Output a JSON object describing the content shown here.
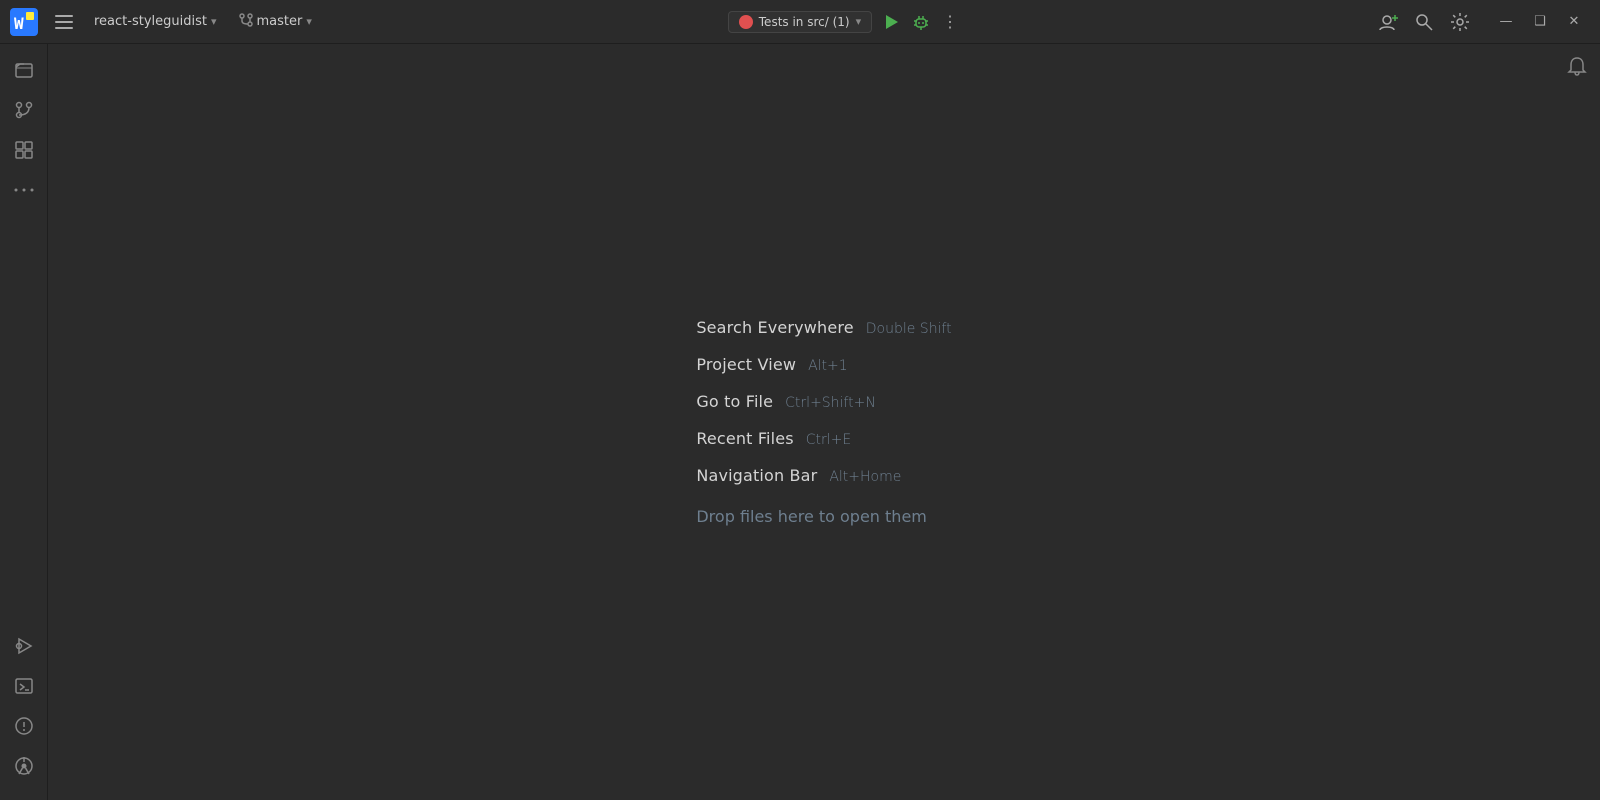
{
  "titlebar": {
    "project_name": "react-styleguidist",
    "branch_name": "master",
    "run_config_label": "Tests in src/ (1)",
    "more_label": "⋮",
    "window_minimize": "—",
    "window_maximize": "❑",
    "window_close": "✕"
  },
  "sidebar": {
    "top_icons": [
      {
        "name": "folder-icon",
        "symbol": "📁"
      },
      {
        "name": "commit-icon",
        "symbol": "◎"
      },
      {
        "name": "plugins-icon",
        "symbol": "⊞"
      },
      {
        "name": "more-tools-icon",
        "symbol": "···"
      }
    ],
    "bottom_icons": [
      {
        "name": "run-configurations-icon",
        "symbol": "▷"
      },
      {
        "name": "terminal-icon",
        "symbol": "⬛"
      },
      {
        "name": "problems-icon",
        "symbol": "⊙"
      },
      {
        "name": "git-icon",
        "symbol": "⑂"
      }
    ]
  },
  "welcome": {
    "items": [
      {
        "label": "Search Everywhere",
        "shortcut": "Double Shift"
      },
      {
        "label": "Project View",
        "shortcut": "Alt+1"
      },
      {
        "label": "Go to File",
        "shortcut": "Ctrl+Shift+N"
      },
      {
        "label": "Recent Files",
        "shortcut": "Ctrl+E"
      },
      {
        "label": "Navigation Bar",
        "shortcut": "Alt+Home"
      }
    ],
    "drop_label": "Drop files here to open them"
  },
  "colors": {
    "accent_green": "#4caf50",
    "accent_red": "#e05050",
    "bg_dark": "#2b2b2b",
    "bg_darker": "#1e1e1e",
    "text_primary": "#d4d4d4",
    "text_secondary": "#6e7f8f"
  }
}
